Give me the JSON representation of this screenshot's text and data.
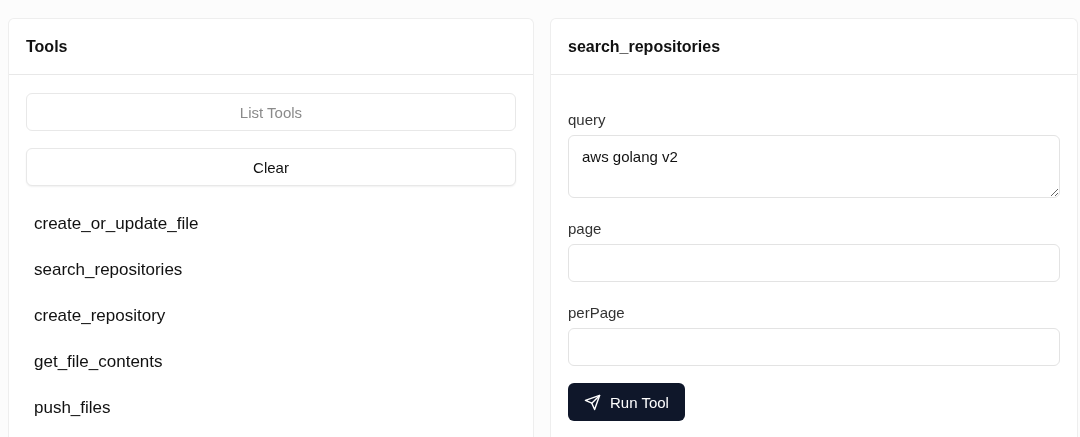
{
  "tools_panel": {
    "title": "Tools",
    "buttons": [
      {
        "label": "List Tools",
        "disabled": true
      },
      {
        "label": "Clear",
        "disabled": false
      }
    ],
    "items": [
      {
        "label": "create_or_update_file",
        "selected": false
      },
      {
        "label": "search_repositories",
        "selected": false
      },
      {
        "label": "create_repository",
        "selected": false
      },
      {
        "label": "get_file_contents",
        "selected": false
      },
      {
        "label": "push_files",
        "selected": false
      }
    ]
  },
  "tool_panel": {
    "title": "search_repositories",
    "fields": [
      {
        "label": "query",
        "kind": "textarea",
        "value": "aws golang v2"
      },
      {
        "label": "page",
        "kind": "input"
      },
      {
        "label": "perPage",
        "kind": "input"
      }
    ],
    "run_button": "Run Tool"
  }
}
